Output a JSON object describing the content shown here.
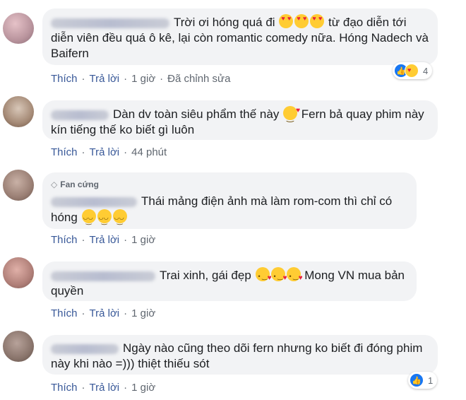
{
  "comments": [
    {
      "badge": "",
      "segments": [
        "Trời ơi hóng quá đi",
        "từ đạo diễn tới diễn viên đều quá ô kê, lại còn romantic comedy nữa. Hóng Nadech và Baifern"
      ],
      "emoji": "heart-eyes",
      "actions": {
        "like": "Thích",
        "reply": "Trả lời",
        "time": "1 giờ",
        "edited": "Đã chỉnh sửa"
      },
      "reactions": {
        "types": [
          "like-icon",
          "care-icon"
        ],
        "count": "4"
      }
    },
    {
      "badge": "",
      "segments": [
        "Dàn dv toàn siêu phẩm thế này",
        "Fern bả quay phim này kín tiếng thế ko biết gì luôn"
      ],
      "emoji": "blush",
      "actions": {
        "like": "Thích",
        "reply": "Trả lời",
        "time": "44 phút"
      }
    },
    {
      "badge": "Fan cứng",
      "segments": [
        "Thái mảng điện ảnh mà làm rom-com thì chỉ có hóng"
      ],
      "emoji": "smile",
      "actions": {
        "like": "Thích",
        "reply": "Trả lời",
        "time": "1 giờ"
      }
    },
    {
      "badge": "",
      "segments": [
        "Trai xinh, gái đẹp",
        "Mong VN mua bản quyền"
      ],
      "emoji": "kiss",
      "actions": {
        "like": "Thích",
        "reply": "Trả lời",
        "time": "1 giờ"
      }
    },
    {
      "badge": "",
      "segments": [
        "Ngày nào cũng theo dõi fern nhưng ko biết đi đóng phim này khi nào =))) thiệt thiếu sót"
      ],
      "emoji": "",
      "actions": {
        "like": "Thích",
        "reply": "Trả lời",
        "time": "1 giờ"
      },
      "reactions": {
        "types": [
          "like-icon"
        ],
        "count": "1"
      }
    }
  ],
  "dot": "·",
  "colors": {
    "bubble": "#f2f3f5",
    "link": "#385898",
    "meta": "#606770",
    "like": "#1877f2"
  }
}
